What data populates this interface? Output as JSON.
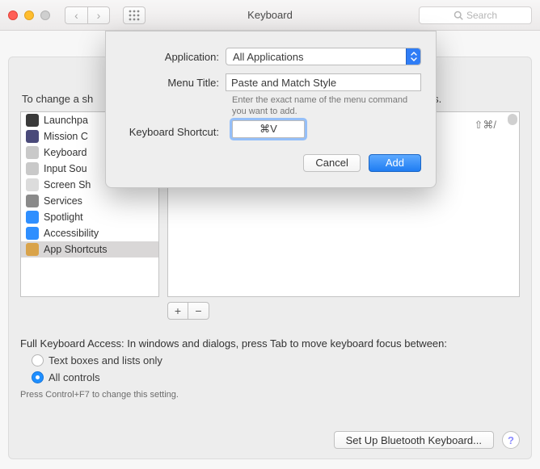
{
  "titlebar": {
    "title": "Keyboard",
    "search_placeholder": "Search"
  },
  "content": {
    "intro_left": "To change a sh",
    "intro_right": "eys."
  },
  "sidebar": {
    "items": [
      {
        "label": "Launchpa"
      },
      {
        "label": "Mission C"
      },
      {
        "label": "Keyboard"
      },
      {
        "label": "Input Sou"
      },
      {
        "label": "Screen Sh"
      },
      {
        "label": "Services"
      },
      {
        "label": "Spotlight"
      },
      {
        "label": "Accessibility"
      },
      {
        "label": "App Shortcuts"
      }
    ]
  },
  "detail": {
    "hint": "⇧⌘/"
  },
  "addremove": {
    "add": "+",
    "remove": "−"
  },
  "fka": {
    "intro": "Full Keyboard Access: In windows and dialogs, press Tab to move keyboard focus between:",
    "opt1": "Text boxes and lists only",
    "opt2": "All controls",
    "hint": "Press Control+F7 to change this setting."
  },
  "footer": {
    "bluetooth": "Set Up Bluetooth Keyboard...",
    "help": "?"
  },
  "sheet": {
    "app_label": "Application:",
    "app_value": "All Applications",
    "menu_label": "Menu Title:",
    "menu_value": "Paste and Match Style",
    "helper": "Enter the exact name of the menu command you want to add.",
    "shortcut_label": "Keyboard Shortcut:",
    "shortcut_value": "⌘V",
    "cancel": "Cancel",
    "add": "Add"
  }
}
